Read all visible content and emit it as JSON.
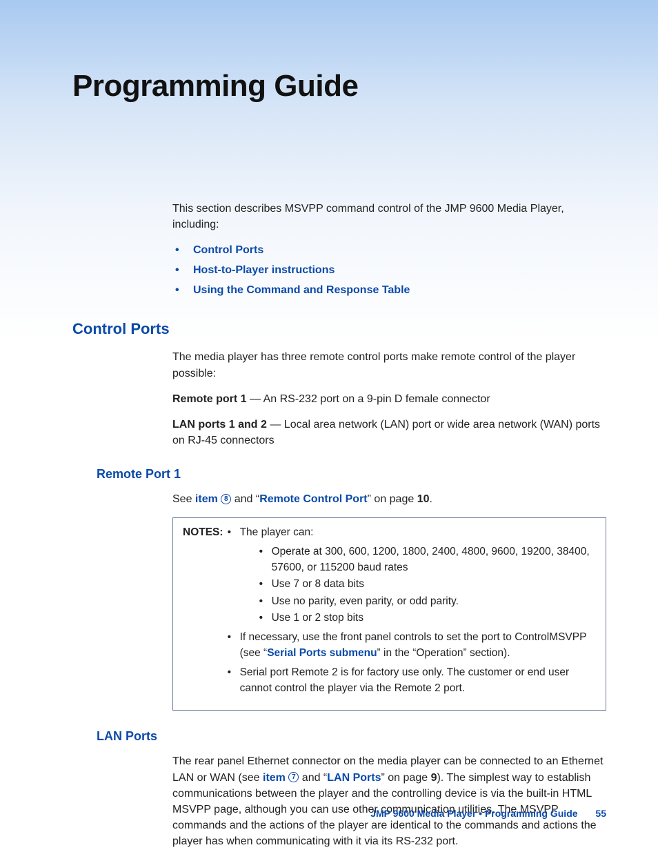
{
  "title": "Programming Guide",
  "intro": "This section describes MSVPP command control of the JMP 9600 Media Player, including:",
  "toc": [
    "Control Ports",
    "Host-to-Player instructions",
    "Using the Command and Response Table"
  ],
  "s1": {
    "heading": "Control Ports",
    "p1": "The media player has three remote control ports make remote control of the player possible:",
    "rp1_label": "Remote port 1",
    "rp1_text": " — An RS-232 port on a 9-pin D female connector",
    "lan_label": "LAN ports 1 and 2",
    "lan_text": " — Local area network (LAN) port or wide area network (WAN) ports on RJ-45 connectors"
  },
  "s2": {
    "heading": "Remote Port 1",
    "see_pre": "See ",
    "item_link": "item ",
    "item_num": "8",
    "and_quote": " and “",
    "rcp_link": "Remote Control Port",
    "close_quote_page": "” on page ",
    "page": "10",
    "period": "."
  },
  "notes": {
    "label": "NOTES:",
    "b1": "The player can:",
    "i1": "Operate at 300, 600, 1200, 1800, 2400, 4800, 9600, 19200, 38400, 57600, or 115200 baud rates",
    "i2": "Use 7 or 8 data bits",
    "i3": "Use no parity, even parity, or odd parity.",
    "i4": "Use 1 or 2 stop bits",
    "b2_pre": "If necessary, use the front panel controls to set the port to ControlMSVPP (see “",
    "b2_link": "Serial Ports submenu",
    "b2_post": "” in the “Operation” section).",
    "b3": "Serial port Remote 2 is for factory use only. The customer or end user cannot control the player via the Remote 2 port."
  },
  "s3": {
    "heading": "LAN Ports",
    "p_pre": "The rear panel Ethernet connector on the media player can be connected to an Ethernet LAN or WAN (see ",
    "item_link": "item ",
    "item_num": "7",
    "and_quote": " and “",
    "lan_link": "LAN Ports",
    "close_quote_page": "” on page ",
    "page": "9",
    "p_post": "). The simplest way to establish communications between the player and the controlling device is via the built-in HTML MSVPP page, although you can use other communication utilities. The MSVPP commands and the actions of the player are identical to the commands and actions the player has when communicating with it via its RS-232 port."
  },
  "footer": {
    "text": "JMP 9600 Media Player • Programming Guide",
    "page": "55"
  }
}
